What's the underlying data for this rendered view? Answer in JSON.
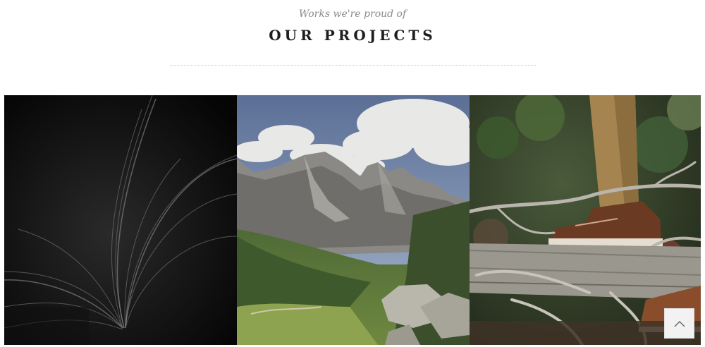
{
  "section": {
    "subtitle": "Works we're proud of",
    "title": "OUR PROJECTS"
  },
  "projects": [
    {
      "name": "book-photo",
      "icon": "open-book-image"
    },
    {
      "name": "mountain-photo",
      "icon": "mountain-landscape-image"
    },
    {
      "name": "hiking-photo",
      "icon": "boots-on-log-image"
    }
  ],
  "scroll_top": {
    "icon": "chevron-up-icon"
  }
}
